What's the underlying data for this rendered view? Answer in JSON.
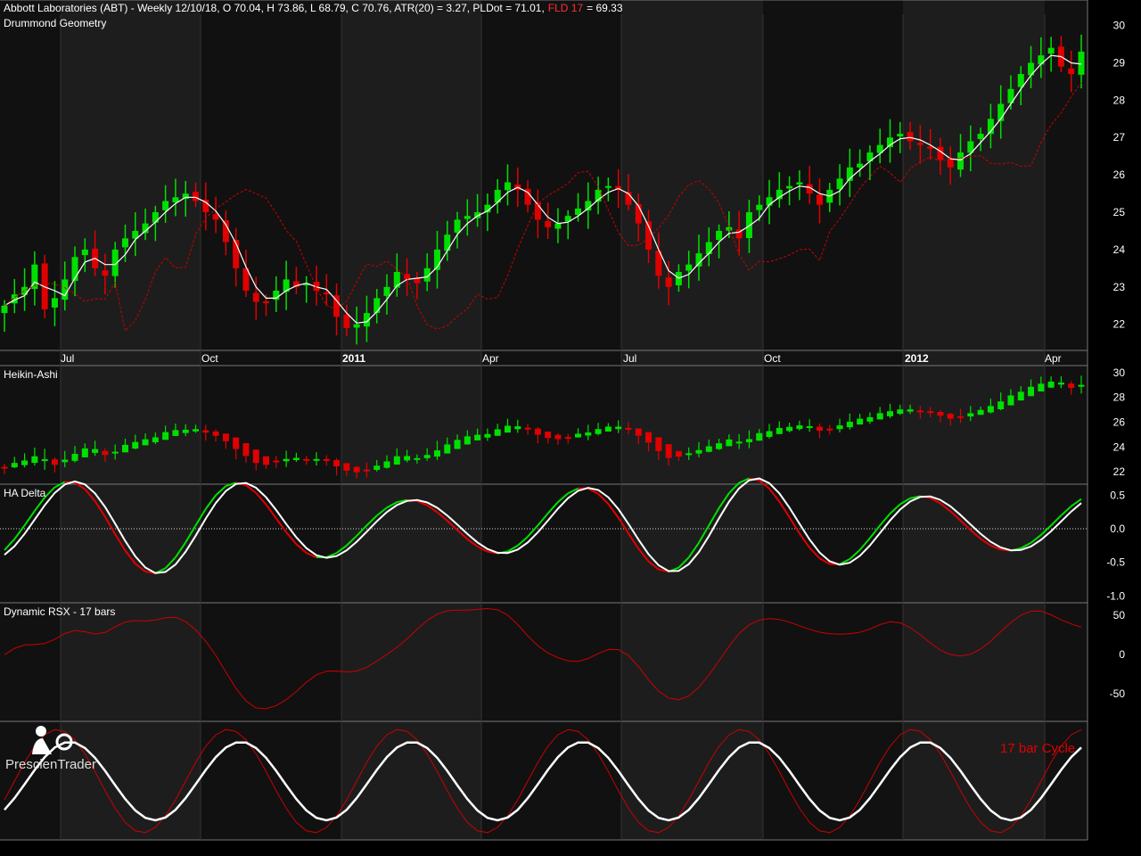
{
  "header": {
    "title": "Abbott Laboratories (ABT) - Weekly 12/10/18, O 70.04, H 73.86, L 68.79, C 70.76, ATR(20) = 3.27, PLDot = 71.01,",
    "fld_label": "FLD 17",
    "fld_value": "= 69.33"
  },
  "panels": {
    "price": "Drummond Geometry",
    "ha": "Heikin-Ashi",
    "delta": "HA Delta",
    "rsx": "Dynamic RSX - 17 bars",
    "cycle": "17 bar Cycle"
  },
  "logo": {
    "text": "PrescienTrader"
  },
  "colors": {
    "up": "#00e000",
    "down": "#e00000",
    "pldot": "#ffffff",
    "fld": "#cc0000",
    "bg_dark": "#111111",
    "bg_light": "#1d1d1d"
  },
  "chart_data": [
    {
      "type": "candlestick",
      "name": "Drummond Geometry",
      "x_tick_labels": [
        "Jul",
        "Oct",
        "2011",
        "Apr",
        "Jul",
        "Oct",
        "2012",
        "Apr"
      ],
      "y_ticks": [
        22,
        23,
        24,
        25,
        26,
        27,
        28,
        29,
        30
      ],
      "ylim": [
        21.3,
        30.3
      ],
      "closes": [
        22.5,
        22.8,
        23.0,
        23.6,
        22.4,
        22.7,
        23.2,
        23.8,
        24.0,
        23.5,
        23.3,
        24.0,
        24.3,
        24.5,
        24.7,
        25.0,
        25.3,
        25.4,
        25.5,
        25.3,
        25.0,
        24.8,
        24.2,
        23.5,
        22.9,
        22.6,
        22.6,
        22.9,
        23.2,
        23.0,
        23.1,
        22.9,
        22.8,
        22.2,
        21.9,
        22.0,
        22.3,
        22.7,
        23.0,
        23.4,
        23.2,
        23.1,
        23.5,
        24.0,
        24.4,
        24.8,
        24.9,
        25.0,
        25.2,
        25.6,
        25.8,
        25.6,
        25.2,
        24.8,
        24.6,
        24.7,
        24.9,
        25.1,
        25.3,
        25.6,
        25.7,
        25.6,
        25.2,
        24.7,
        24.0,
        23.3,
        23.0,
        23.4,
        23.6,
        23.9,
        24.2,
        24.5,
        24.6,
        24.3,
        25.0,
        25.2,
        25.4,
        25.6,
        25.7,
        25.8,
        25.5,
        25.2,
        25.6,
        25.9,
        26.2,
        26.3,
        26.6,
        26.8,
        27.0,
        27.1,
        26.9,
        26.8,
        26.7,
        26.4,
        26.2,
        26.6,
        26.9,
        27.1,
        27.5,
        27.9,
        28.3,
        28.7,
        29.0,
        29.2,
        29.4,
        28.9,
        28.7,
        29.3
      ]
    },
    {
      "type": "candlestick",
      "name": "Heikin-Ashi",
      "y_ticks": [
        22,
        24,
        26,
        28,
        30
      ],
      "ylim": [
        21.0,
        30.5
      ]
    },
    {
      "type": "line",
      "name": "HA Delta",
      "y_ticks": [
        -1.0,
        -0.5,
        0.0,
        0.5
      ],
      "ylim": [
        -1.1,
        0.65
      ]
    },
    {
      "type": "line",
      "name": "Dynamic RSX - 17 bars",
      "y_ticks": [
        -50,
        0,
        50
      ],
      "ylim": [
        -85,
        65
      ]
    },
    {
      "type": "line",
      "name": "17 bar Cycle",
      "period_bars": 17
    }
  ]
}
